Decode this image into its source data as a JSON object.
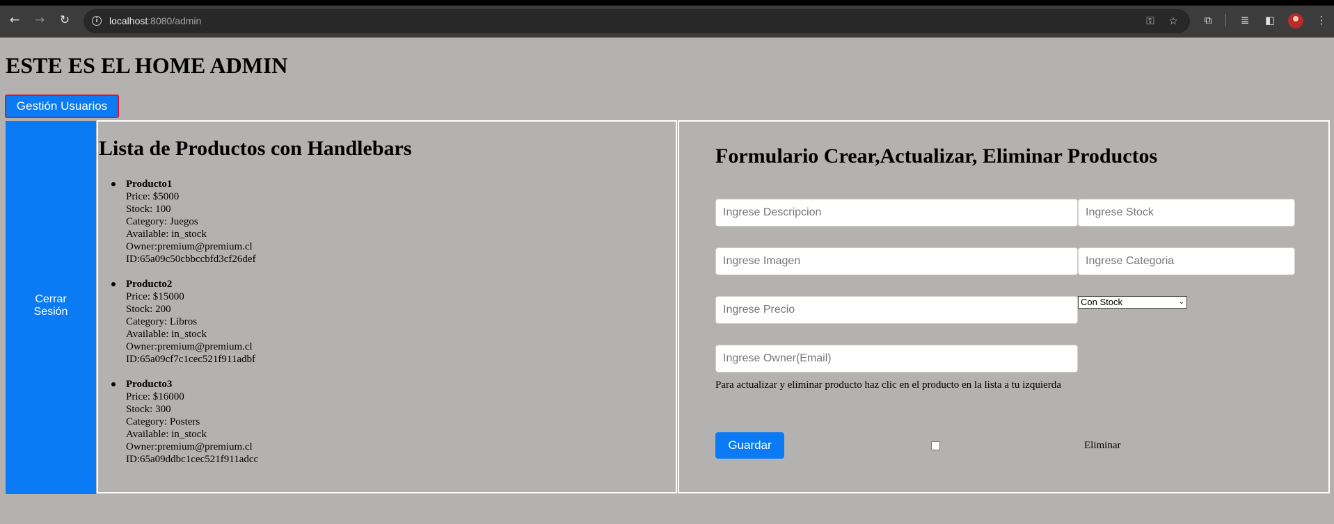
{
  "browser": {
    "url_host": "localhost",
    "url_path": ":8080/admin",
    "icons": {
      "back": "←",
      "forward": "→",
      "reload": "↻",
      "info": "i",
      "key": "⚿",
      "star": "☆",
      "extensions": "⧉",
      "media": "≣",
      "sidepanel": "◧",
      "menu": "⋮"
    }
  },
  "header": {
    "title": "ESTE ES EL HOME ADMIN",
    "users_button": "Gestión Usuarios"
  },
  "sidebar": {
    "logout_label": "Cerrar\nSesión"
  },
  "product_list": {
    "title": "Lista de Productos con Handlebars",
    "items": [
      {
        "name": "Producto1",
        "price": "Price: $5000",
        "stock": "Stock: 100",
        "category": "Category: Juegos",
        "available": "Available: in_stock",
        "owner": "Owner:premium@premium.cl",
        "id": "ID:65a09c50cbbccbfd3cf26def"
      },
      {
        "name": "Producto2",
        "price": "Price: $15000",
        "stock": "Stock: 200",
        "category": "Category: Libros",
        "available": "Available: in_stock",
        "owner": "Owner:premium@premium.cl",
        "id": "ID:65a09cf7c1cec521f911adbf"
      },
      {
        "name": "Producto3",
        "price": "Price: $16000",
        "stock": "Stock: 300",
        "category": "Category: Posters",
        "available": "Available: in_stock",
        "owner": "Owner:premium@premium.cl",
        "id": "ID:65a09ddbc1cec521f911adcc"
      }
    ]
  },
  "form": {
    "title": "Formulario Crear,Actualizar, Eliminar Productos",
    "placeholders": {
      "description": "Ingrese Descripcion",
      "stock": "Ingrese Stock",
      "image": "Ingrese Imagen",
      "category": "Ingrese Categoria",
      "price": "Ingrese Precio",
      "owner": "Ingrese Owner(Email)"
    },
    "stock_select_value": "Con Stock",
    "hint": "Para actualizar y eliminar producto haz clic en el producto en la lista a tu izquierda",
    "save_label": "Guardar",
    "delete_label": "Eliminar"
  },
  "colors": {
    "page_bg": "#b3b2b0",
    "accent_blue": "#0a7bf5",
    "highlight_red": "#e1142c"
  }
}
